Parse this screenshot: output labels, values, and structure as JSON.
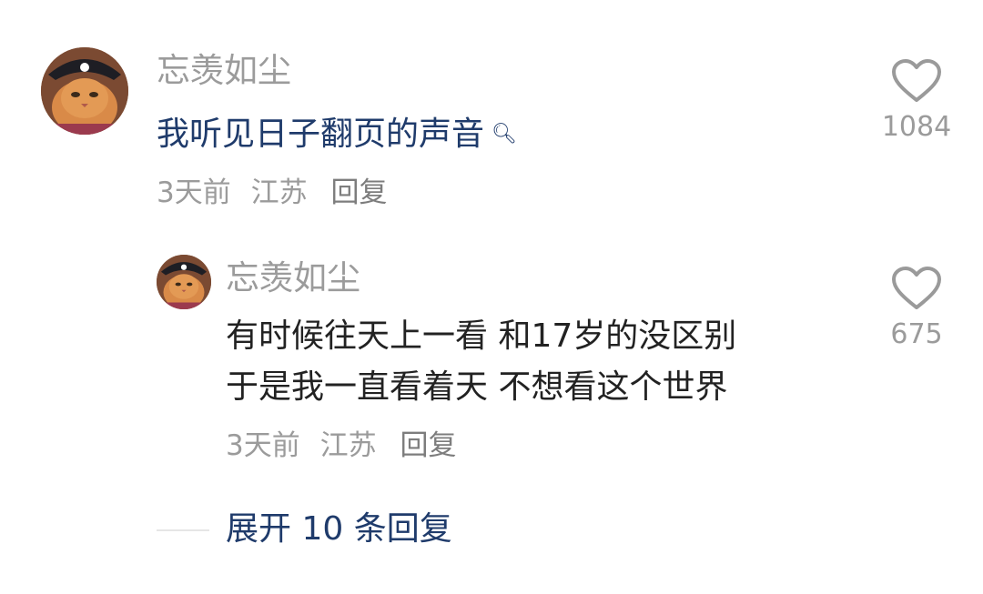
{
  "colors": {
    "link_blue": "#1f3b6b",
    "reply_text": "#222222",
    "muted_gray": "#9b9b9b",
    "heart_stroke": "#9a9a9a"
  },
  "comment": {
    "username": "忘羡如尘",
    "text": "我听见日子翻页的声音",
    "search_icon": "search-icon",
    "time": "3天前",
    "location": "江苏",
    "reply_label": "回复",
    "like_count": "1084"
  },
  "reply": {
    "username": "忘羡如尘",
    "lines": [
      "有时候往天上一看  和17岁的没区别",
      "于是我一直看着天  不想看这个世界"
    ],
    "time": "3天前",
    "location": "江苏",
    "reply_label": "回复",
    "like_count": "675"
  },
  "expand": {
    "label": "展开 10 条回复"
  }
}
